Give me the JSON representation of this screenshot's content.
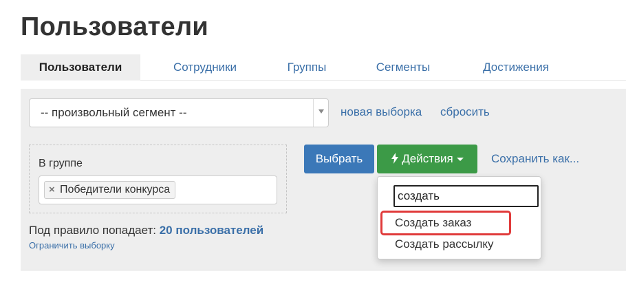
{
  "page": {
    "title": "Пользователи"
  },
  "tabs": [
    {
      "label": "Пользователи",
      "active": true
    },
    {
      "label": "Сотрудники",
      "active": false
    },
    {
      "label": "Группы",
      "active": false
    },
    {
      "label": "Сегменты",
      "active": false
    },
    {
      "label": "Достижения",
      "active": false
    }
  ],
  "filter": {
    "segment_value": "-- произвольный сегмент --",
    "new_selection_label": "новая выборка",
    "reset_label": "сбросить"
  },
  "rule": {
    "label": "В группе",
    "tag": "Победители конкурса",
    "tag_remove": "×"
  },
  "actions": {
    "select_label": "Выбрать",
    "actions_label": "Действия",
    "save_as_label": "Сохранить как..."
  },
  "summary": {
    "prefix": "Под правило попадает:",
    "count": "20 пользователей",
    "limit_label": "Ограничить выборку"
  },
  "dropdown": {
    "search_value": "создать",
    "items": [
      "Создать заказ",
      "Создать рассылку"
    ],
    "highlighted_index": 0
  },
  "colors": {
    "link": "#3a6fa8",
    "primary": "#3b78b8",
    "success": "#3c9a47",
    "highlight": "#e03a3a"
  }
}
